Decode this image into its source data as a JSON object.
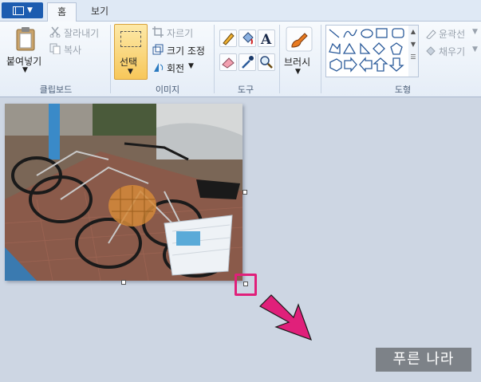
{
  "tabs": {
    "home": "홈",
    "view": "보기"
  },
  "clipboard": {
    "paste": "붙여넣기",
    "cut": "잘라내기",
    "copy": "복사",
    "group": "클립보드"
  },
  "image": {
    "select": "선택",
    "crop": "자르기",
    "resize": "크기 조정",
    "rotate": "회전",
    "group": "이미지"
  },
  "tools": {
    "group": "도구"
  },
  "brushes": {
    "label": "브러시"
  },
  "shapes": {
    "outline": "윤곽선",
    "fill": "채우기",
    "group": "도형"
  },
  "watermark": "푸른 나라",
  "colors": {
    "highlight": "#e0207a",
    "accent": "#1c5cb0"
  }
}
